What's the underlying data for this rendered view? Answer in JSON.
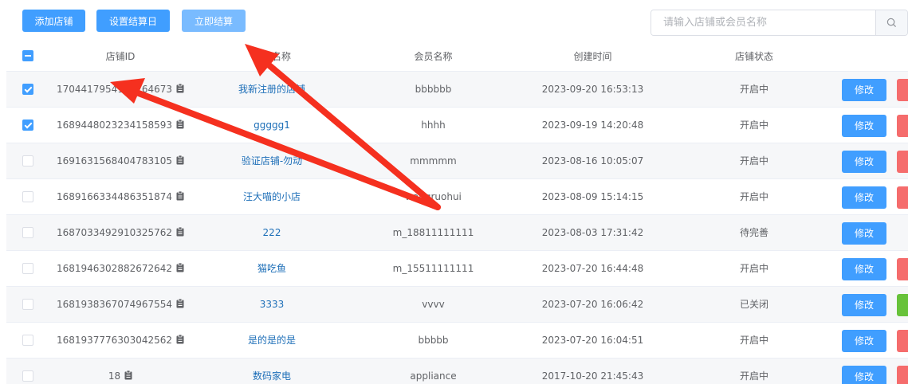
{
  "toolbar": {
    "add_label": "添加店铺",
    "settle_day_label": "设置结算日",
    "settle_now_label": "立即结算",
    "search_placeholder": "请输入店铺或会员名称"
  },
  "table": {
    "headers": {
      "id": "店铺ID",
      "name": "店铺名称",
      "member": "会员名称",
      "created": "创建时间",
      "status": "店铺状态"
    },
    "edit_label": "修改",
    "rows": [
      {
        "checked": true,
        "id": "1704417954164164673",
        "name": "我新注册的店铺",
        "member": "bbbbbb",
        "created": "2023-09-20 16:53:13",
        "status": "开启中",
        "side": "red"
      },
      {
        "checked": true,
        "id": "1689448023234158593",
        "name": "ggggg1",
        "member": "hhhh",
        "created": "2023-09-19 14:20:48",
        "status": "开启中",
        "side": "red"
      },
      {
        "checked": false,
        "id": "1691631568404783105",
        "name": "验证店铺-勿动",
        "member": "mmmmm",
        "created": "2023-08-16 10:05:07",
        "status": "开启中",
        "side": "red"
      },
      {
        "checked": false,
        "id": "1689166334486351874",
        "name": "汪大喵的小店",
        "member": "wangruohui",
        "created": "2023-08-09 15:14:15",
        "status": "开启中",
        "side": "red"
      },
      {
        "checked": false,
        "id": "1687033492910325762",
        "name": "222",
        "member": "m_18811111111",
        "created": "2023-08-03 17:31:42",
        "status": "待完善",
        "side": ""
      },
      {
        "checked": false,
        "id": "1681946302882672642",
        "name": "猫吃鱼",
        "member": "m_15511111111",
        "created": "2023-07-20 16:44:48",
        "status": "开启中",
        "side": "red"
      },
      {
        "checked": false,
        "id": "1681938367074967554",
        "name": "3333",
        "member": "vvvv",
        "created": "2023-07-20 16:06:42",
        "status": "已关闭",
        "side": "green"
      },
      {
        "checked": false,
        "id": "1681937776303042562",
        "name": "是的是的是",
        "member": "bbbbb",
        "created": "2023-07-20 16:04:51",
        "status": "开启中",
        "side": "red"
      },
      {
        "checked": false,
        "id": "18",
        "name": "数码家电",
        "member": "appliance",
        "created": "2017-10-20 21:45:43",
        "status": "开启中",
        "side": "red"
      }
    ]
  },
  "colors": {
    "primary": "#409eff",
    "danger": "#f56c6c",
    "success": "#67c23a",
    "link": "#1e6fb8",
    "annotation_arrow": "#f5301f"
  }
}
